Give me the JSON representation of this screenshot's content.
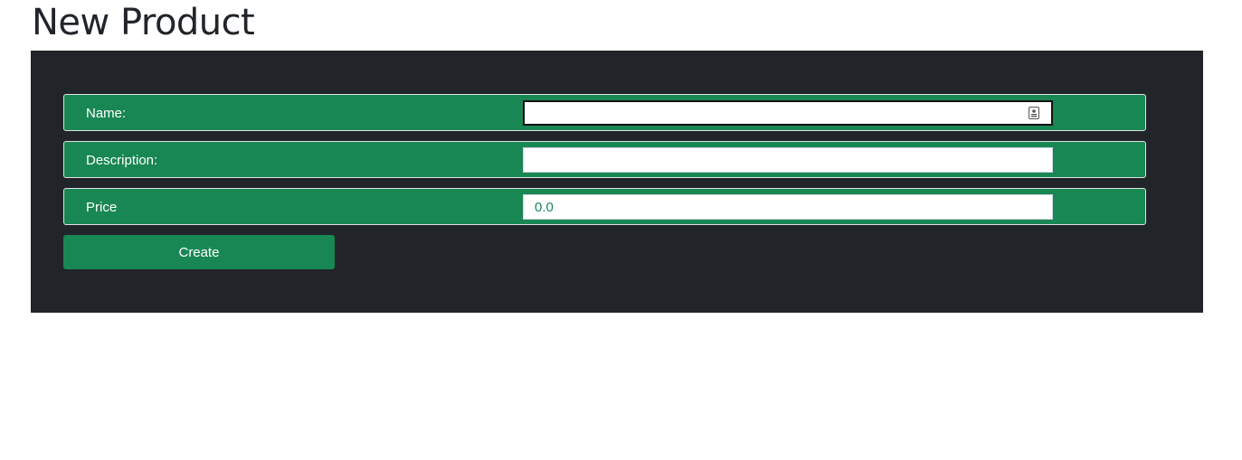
{
  "page": {
    "title": "New Product"
  },
  "form": {
    "name": {
      "label": "Name:",
      "value": ""
    },
    "description": {
      "label": "Description:",
      "value": ""
    },
    "price": {
      "label": "Price",
      "value": "0.0"
    },
    "submit_label": "Create"
  },
  "colors": {
    "accent": "#198754",
    "panel_background": "#212429",
    "title_text": "#212529"
  },
  "icons": {
    "name_field_icon": "autofill-contact-icon"
  }
}
